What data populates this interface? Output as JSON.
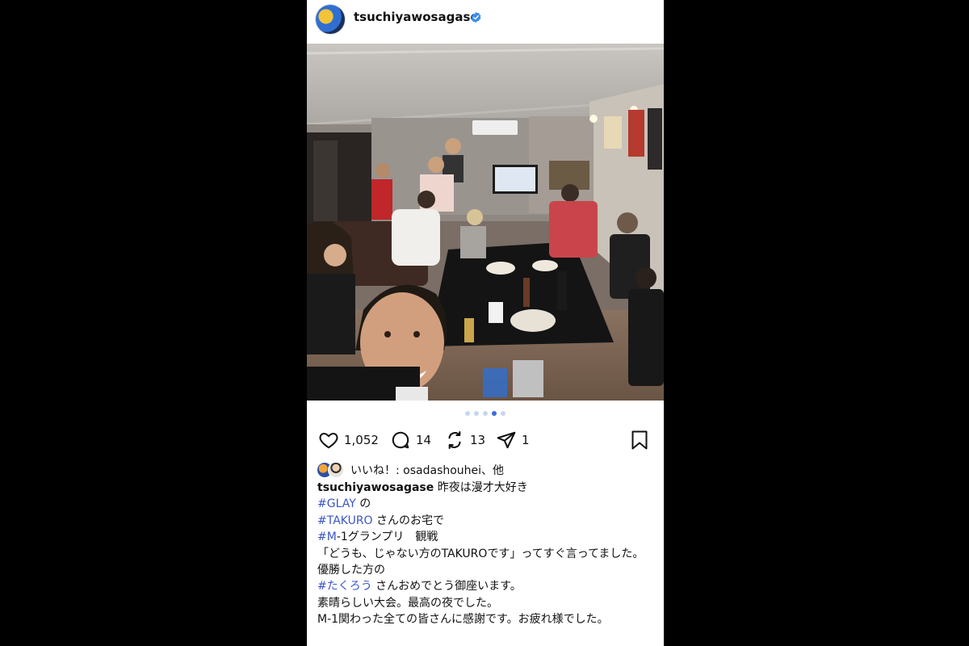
{
  "post": {
    "username": "tsuchiyawosagase",
    "verified_icon": "verified-badge-icon",
    "carousel": {
      "total": 5,
      "active_index": 3
    },
    "actions": {
      "likes": "1,052",
      "comments": "14",
      "reposts": "13",
      "shares": "1"
    },
    "liked_by": "いいね！: osadashouhei、他",
    "caption": {
      "user": "tsuchiyawosagase",
      "first": "昨夜は漫才大好き",
      "lines": [
        {
          "tag": "#GLAY",
          "text": " の"
        },
        {
          "tag": "#TAKURO",
          "text": " さんのお宅で"
        },
        {
          "tag": "#M",
          "text": "-1グランプリ　観戦"
        },
        {
          "tag": "",
          "text": "「どうも、じゃない方のTAKUROです」ってすぐ言ってました。"
        },
        {
          "tag": "",
          "text": "優勝した方の"
        },
        {
          "tag": "#たくろう",
          "text": " さんおめでとう御座います。"
        },
        {
          "tag": "",
          "text": "素晴らしい大会。最高の夜でした。"
        },
        {
          "tag": "",
          "text": "M-1関わった全ての皆さんに感謝です。お疲れ様でした。"
        }
      ]
    },
    "colors": {
      "hashtag": "#3b56c7",
      "verified": "#3b8cf0",
      "active_dot": "#3b6fd6"
    }
  }
}
